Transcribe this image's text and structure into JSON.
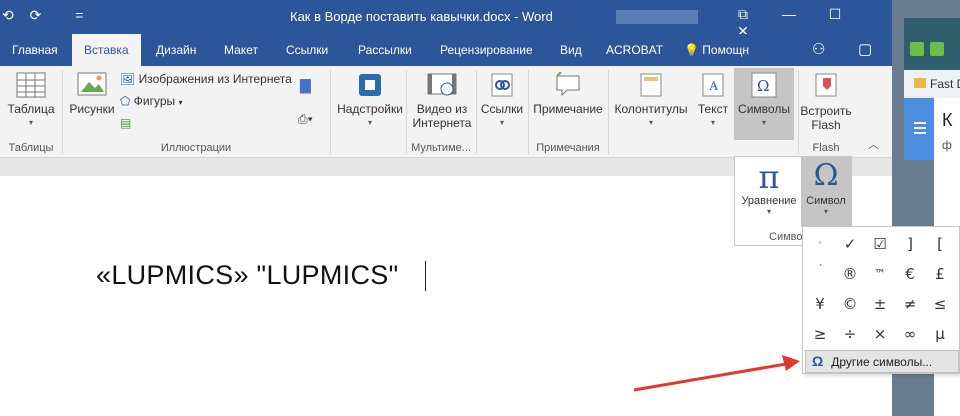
{
  "titlebar": {
    "title": "Как в Ворде поставить кавычки.docx - Word",
    "qat": [
      "⟲",
      "⟳",
      "="
    ],
    "ctrls": [
      "⧉",
      "—",
      "☐",
      "✕"
    ]
  },
  "tabs": [
    "Главная",
    "Вставка",
    "Дизайн",
    "Макет",
    "Ссылки",
    "Рассылки",
    "Рецензирование",
    "Вид",
    "ACROBAT",
    "Помощн"
  ],
  "ribbon": {
    "table": "Таблица",
    "group_tables": "Таблицы",
    "pictures": "Рисунки",
    "online_images": "Изображения из Интернета",
    "shapes": "Фигуры",
    "group_illustrations": "Иллюстрации",
    "addins": "Надстройки",
    "video_l1": "Видео из",
    "video_l2": "Интернета",
    "group_media": "Мультиме...",
    "links": "Ссылки",
    "comment": "Примечание",
    "group_comments": "Примечания",
    "headers": "Колонтитулы",
    "text": "Текст",
    "symbols": "Символы",
    "flash_l1": "Встроить",
    "flash_l2": "Flash",
    "group_flash": "Flash"
  },
  "symbols_dropdown": {
    "equation": "Уравнение",
    "symbol": "Символ",
    "group_label": "Симво"
  },
  "symbol_grid": {
    "cells": [
      "◦",
      "✓",
      "☑",
      "]",
      "[",
      "´",
      "®",
      "™",
      "€",
      "£",
      "¥",
      "©",
      "±",
      "≠",
      "≤",
      "≥",
      "÷",
      "×",
      "∞",
      "µ"
    ],
    "more": "Другие символы..."
  },
  "document": {
    "text": "«LUPMICS» \"LUPMICS\""
  },
  "browser": {
    "bookmark": "Fast Dia",
    "k": "К",
    "f": "ф"
  }
}
